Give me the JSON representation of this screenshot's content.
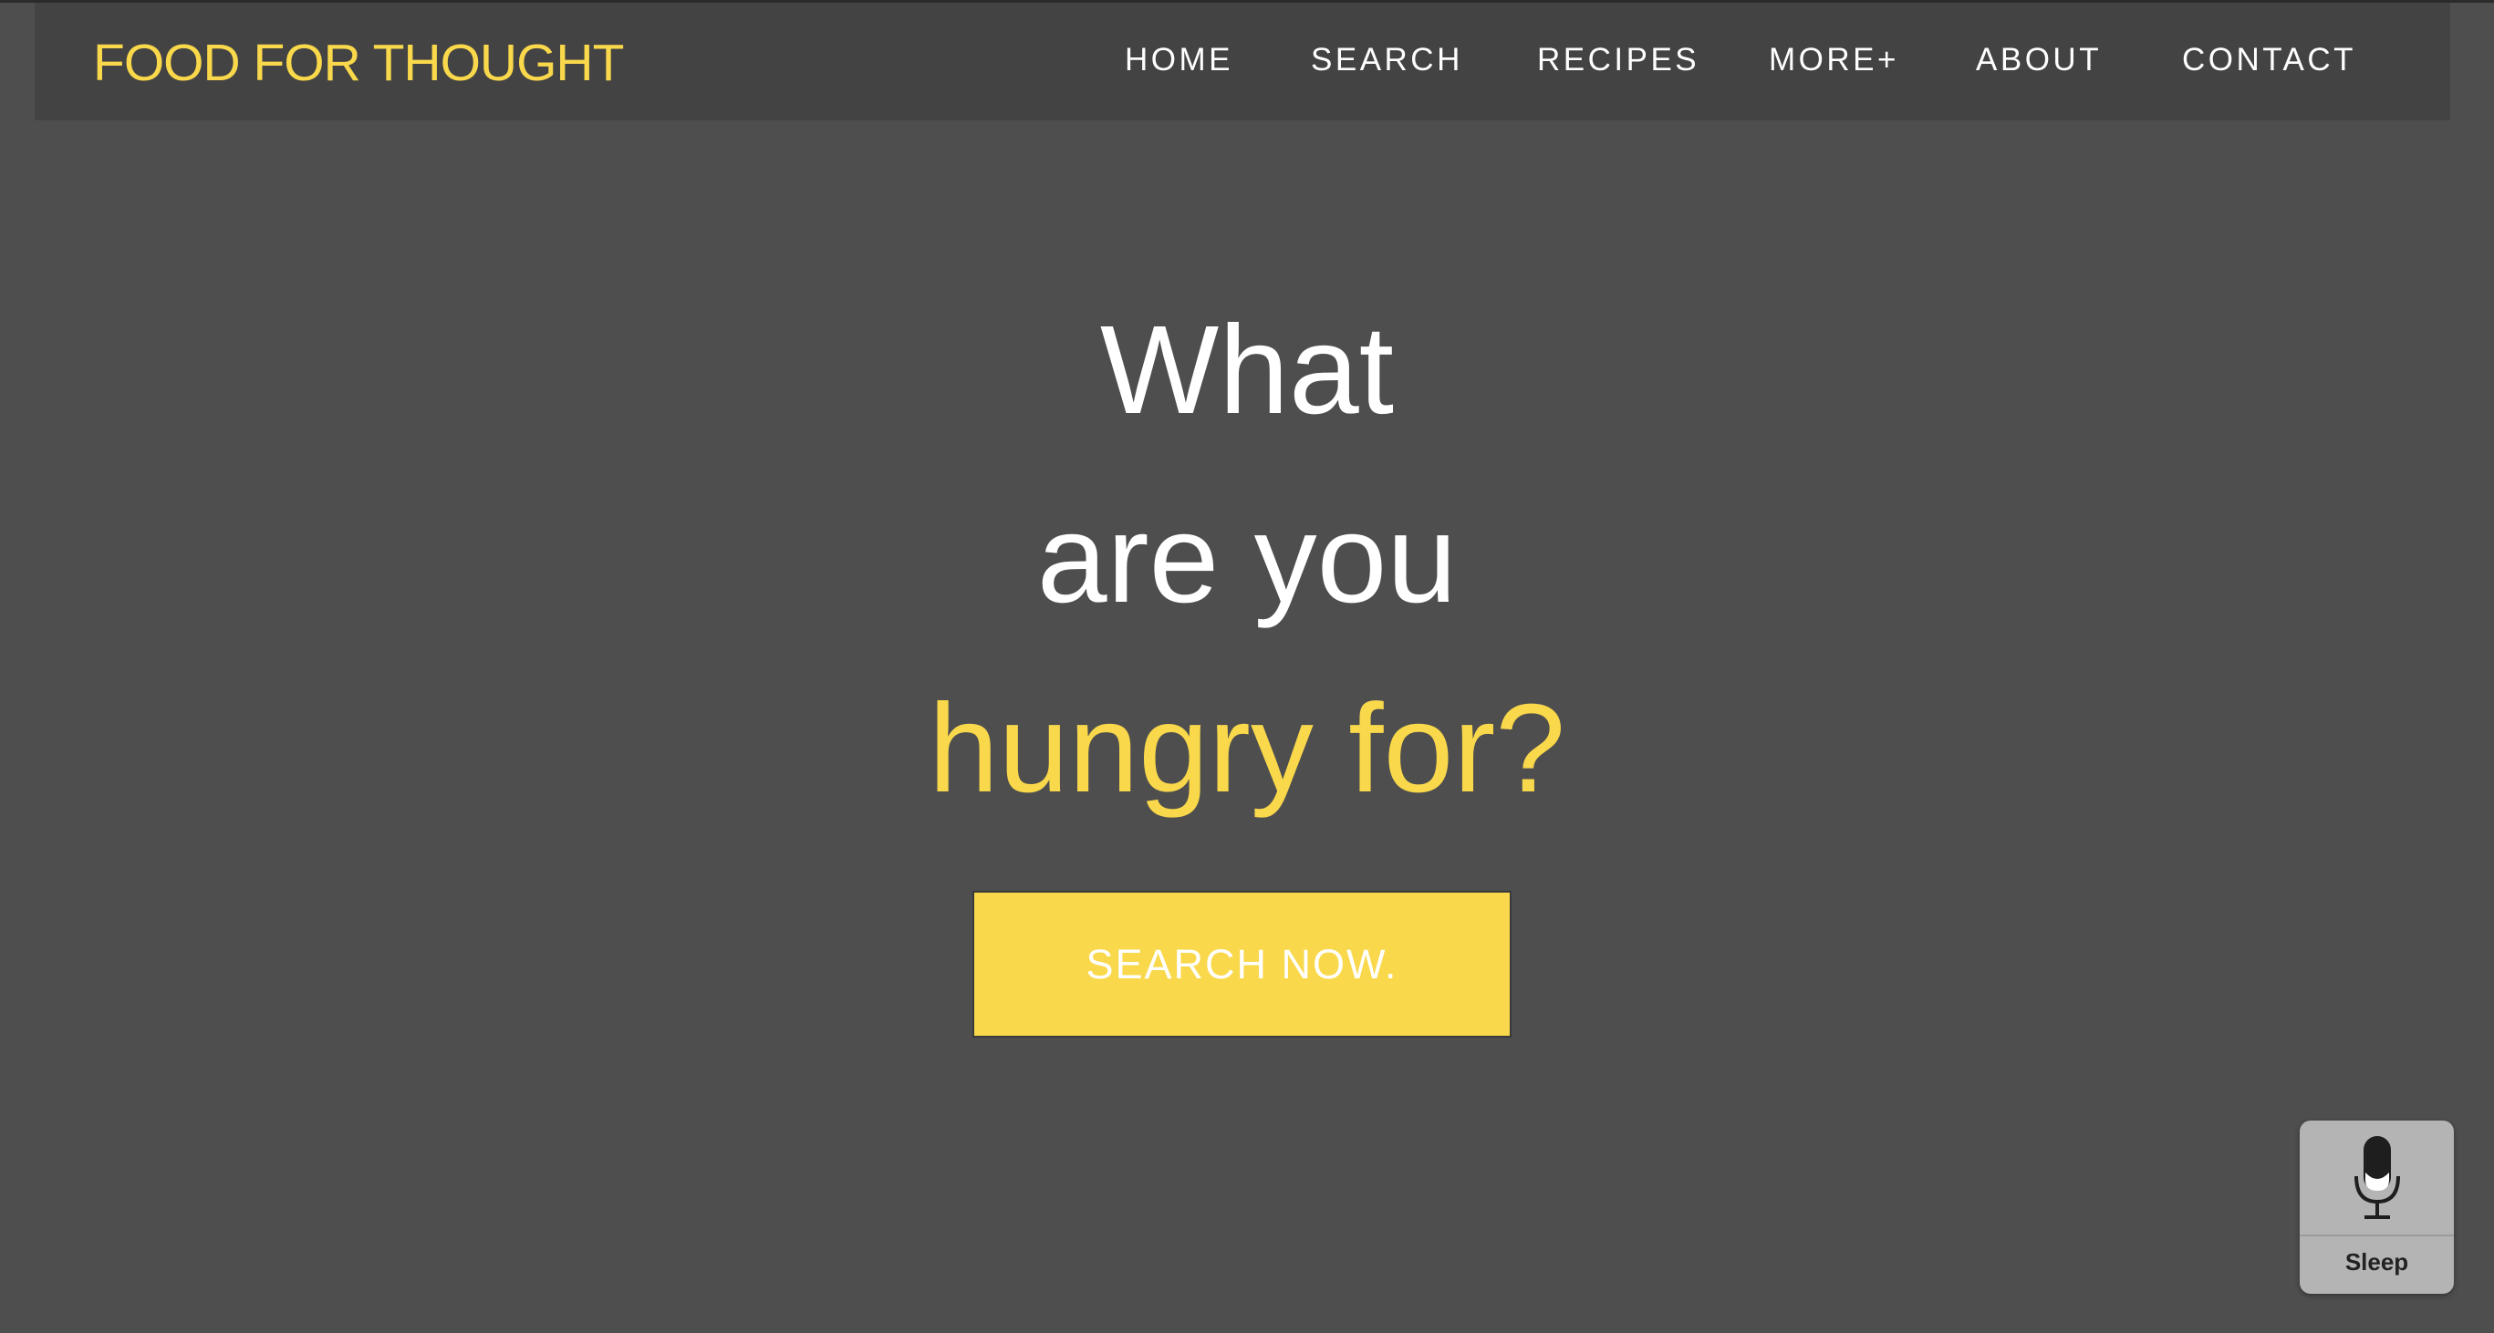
{
  "header": {
    "brand": "FOOD FOR THOUGHT",
    "nav": [
      {
        "label": "HOME"
      },
      {
        "label": "SEARCH"
      },
      {
        "label": "RECIPES"
      },
      {
        "label": "MORE+"
      },
      {
        "label": "ABOUT"
      },
      {
        "label": "CONTACT"
      }
    ]
  },
  "hero": {
    "line1": "What",
    "line2": "are you",
    "line3": "hungry for?",
    "cta_label": "SEARCH NOW."
  },
  "voice_widget": {
    "icon": "microphone-icon",
    "status_label": "Sleep"
  },
  "colors": {
    "background": "#4e4e4e",
    "navbar": "#434343",
    "accent": "#f9d84b",
    "text": "#ffffff"
  }
}
